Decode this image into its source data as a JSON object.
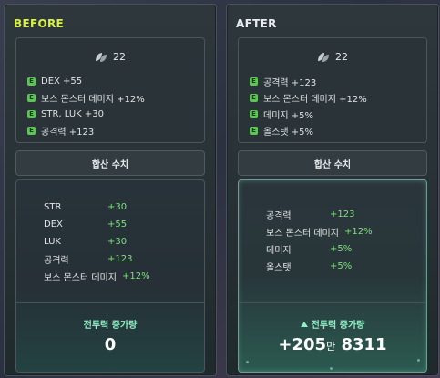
{
  "before": {
    "header": "BEFORE",
    "tier": "22",
    "lines": [
      {
        "badge": "E",
        "text": "DEX +55"
      },
      {
        "badge": "E",
        "text": "보스 몬스터 데미지 +12%"
      },
      {
        "badge": "E",
        "text": "STR, LUK +30"
      },
      {
        "badge": "E",
        "text": "공격력 +123"
      }
    ],
    "sum_button": "합산 수치",
    "stats": [
      {
        "name": "STR",
        "value": "+30"
      },
      {
        "name": "DEX",
        "value": "+55"
      },
      {
        "name": "LUK",
        "value": "+30"
      },
      {
        "name": "공격력",
        "value": "+123"
      },
      {
        "name": "보스 몬스터 데미지",
        "value": "+12%"
      }
    ],
    "cp_label": "전투력 증가량",
    "cp_value": "0"
  },
  "after": {
    "header": "AFTER",
    "tier": "22",
    "lines": [
      {
        "badge": "E",
        "text": "공격력 +123"
      },
      {
        "badge": "E",
        "text": "보스 몬스터 데미지 +12%"
      },
      {
        "badge": "E",
        "text": "데미지 +5%"
      },
      {
        "badge": "E",
        "text": "올스탯 +5%"
      }
    ],
    "sum_button": "합산 수치",
    "stats": [
      {
        "name": "공격력",
        "value": "+123"
      },
      {
        "name": "보스 몬스터 데미지",
        "value": "+12%"
      },
      {
        "name": "데미지",
        "value": "+5%"
      },
      {
        "name": "올스탯",
        "value": "+5%"
      }
    ],
    "cp_label": "전투력 증가량",
    "cp_value": {
      "prefix": "+205",
      "unit": "만",
      "rest": "8311"
    }
  },
  "icons": {
    "tier": "leaf-emblem-icon",
    "badge": "rank-e-badge-icon",
    "up": "triangle-up-icon"
  },
  "colors": {
    "before_header": "#d9f046",
    "stat_value": "#7ce07a",
    "cp_label": "#8ff0c4",
    "badge": "#5fc35a"
  }
}
